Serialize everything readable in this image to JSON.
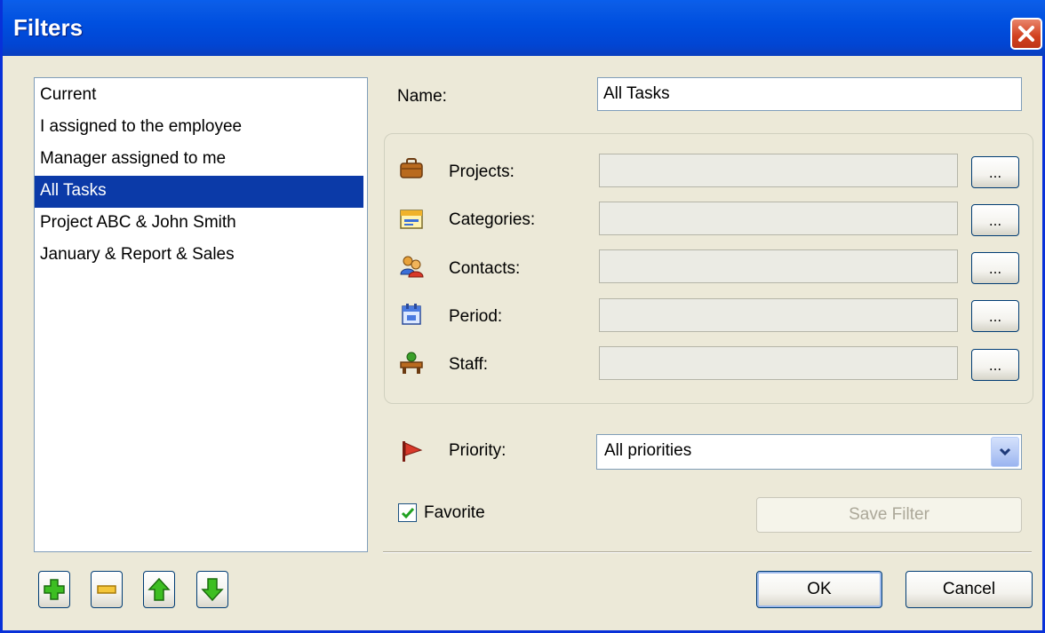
{
  "window": {
    "title": "Filters"
  },
  "filters": [
    {
      "label": "Current",
      "selected": false
    },
    {
      "label": "I assigned to the employee",
      "selected": false
    },
    {
      "label": "Manager assigned to me",
      "selected": false
    },
    {
      "label": "All Tasks",
      "selected": true
    },
    {
      "label": "Project ABC & John Smith",
      "selected": false
    },
    {
      "label": "January & Report & Sales",
      "selected": false
    }
  ],
  "toolbar": {
    "add_icon": "plus-icon",
    "remove_icon": "minus-icon",
    "up_icon": "arrow-up-icon",
    "down_icon": "arrow-down-icon"
  },
  "form": {
    "name_label": "Name:",
    "name_value": "All Tasks",
    "projects_label": "Projects:",
    "projects_value": "",
    "categories_label": "Categories:",
    "categories_value": "",
    "contacts_label": "Contacts:",
    "contacts_value": "",
    "period_label": "Period:",
    "period_value": "",
    "staff_label": "Staff:",
    "staff_value": "",
    "browse_label": "...",
    "priority_label": "Priority:",
    "priority_value": "All priorities",
    "favorite_label": "Favorite",
    "favorite_checked": true,
    "save_filter_label": "Save Filter"
  },
  "buttons": {
    "ok": "OK",
    "cancel": "Cancel"
  },
  "colors": {
    "titlebar": "#0050E0",
    "selection": "#0B3AA8",
    "window_bg": "#ECE9D8",
    "close": "#D1401E"
  }
}
